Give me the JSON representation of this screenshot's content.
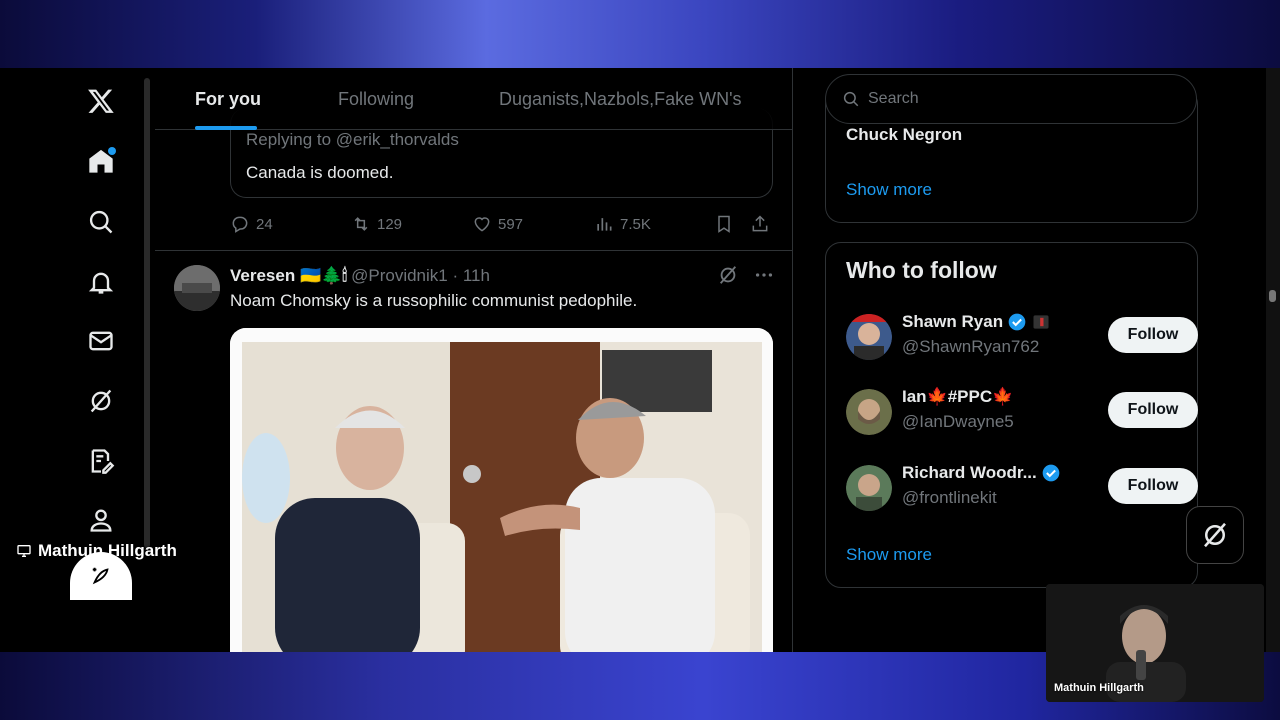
{
  "tabs": [
    {
      "label": "For you",
      "active": true
    },
    {
      "label": "Following",
      "active": false
    },
    {
      "label": "Duganists,Nazbols,Fake WN's",
      "active": false
    }
  ],
  "quote": {
    "replying": "Replying to @erik_thorvalds",
    "text": "Canada is doomed."
  },
  "actions": {
    "replies": "24",
    "reposts": "129",
    "likes": "597",
    "views": "7.5K"
  },
  "post": {
    "name": "Veresen 🇺🇦🌲🕯",
    "handle": "@Providnik1 · 11h",
    "text": "Noam Chomsky is a russophilic communist pedophile."
  },
  "search": {
    "placeholder": "Search"
  },
  "trending": {
    "item": "Chuck Negron",
    "show_more": "Show more"
  },
  "who_to_follow": {
    "title": "Who to follow",
    "users": [
      {
        "name": "Shawn Ryan",
        "handle": "@ShawnRyan762",
        "verified": true,
        "follow": "Follow"
      },
      {
        "name": "Ian🍁#PPC🍁",
        "handle": "@IanDwayne5",
        "verified": false,
        "follow": "Follow"
      },
      {
        "name": "Richard Woodr...",
        "handle": "@frontlinekit",
        "verified": true,
        "follow": "Follow"
      }
    ],
    "show_more": "Show more"
  },
  "stream": {
    "left_label": "Mathuin Hillgarth",
    "webcam_label": "Mathuin Hillgarth"
  },
  "colors": {
    "accent": "#1d9bf0",
    "background": "#000000",
    "border": "#2f3336",
    "muted": "#71767b"
  }
}
